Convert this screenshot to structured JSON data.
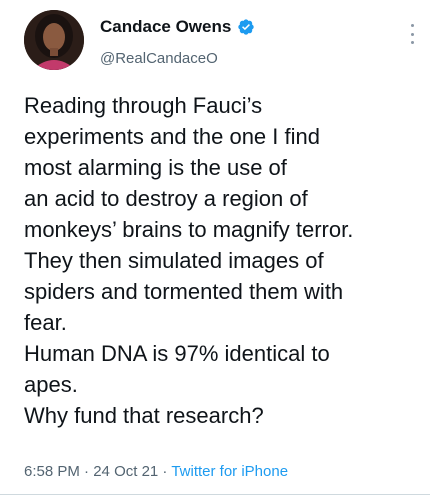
{
  "author": {
    "display_name": "Candace Owens",
    "handle": "@RealCandaceO",
    "verified": true,
    "avatar_icon": "profile-photo"
  },
  "tweet": {
    "lines": [
      "Reading through Fauci’s",
      "experiments and the one I find",
      "most alarming is the use of",
      "an acid to destroy a region of",
      "monkeys’ brains to magnify terror.",
      "They then simulated images of",
      "spiders and tormented them with",
      "fear.",
      "Human DNA is 97% identical to",
      "apes.",
      "Why fund that research?"
    ]
  },
  "meta": {
    "time": "6:58 PM",
    "separator": " · ",
    "date": "24 Oct 21",
    "source": "Twitter for iPhone"
  },
  "colors": {
    "verified": "#1d9bf0",
    "link": "#1d9bf0",
    "secondary_text": "#536471"
  }
}
